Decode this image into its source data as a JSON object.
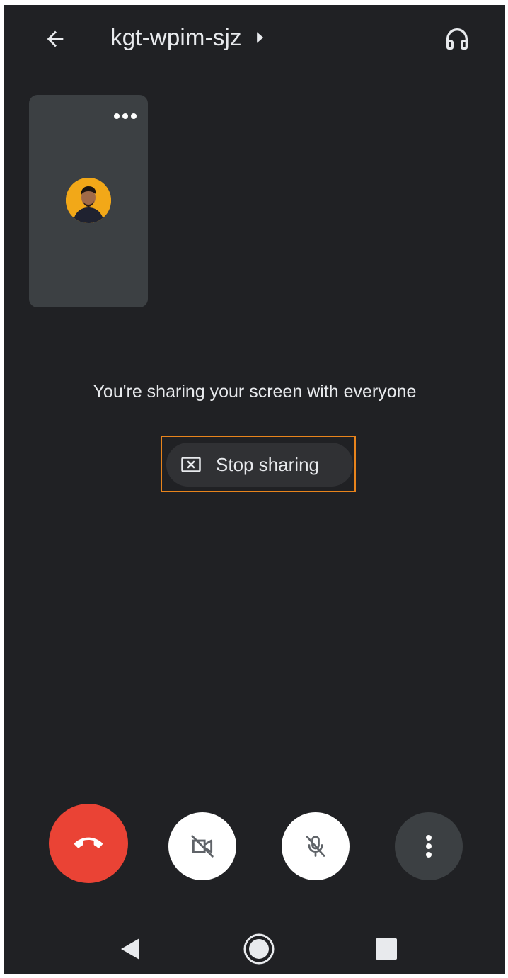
{
  "header": {
    "meeting_code": "kgt-wpim-sjz",
    "back_icon": "arrow-left-icon",
    "caret_icon": "caret-right-icon",
    "audio_icon": "headphones-icon"
  },
  "self_tile": {
    "more_icon": "more-horizontal-icon",
    "avatar_color": "#f2a818"
  },
  "sharing": {
    "message": "You're sharing your screen with everyone",
    "stop_label": "Stop sharing",
    "stop_icon": "stop-share-icon",
    "highlight_color": "#e8841c"
  },
  "controls": {
    "hangup_icon": "phone-hangup-icon",
    "camera_icon": "camera-off-icon",
    "mic_icon": "mic-off-icon",
    "more_icon": "more-vertical-icon",
    "hangup_color": "#ea4335"
  },
  "system_nav": {
    "back_icon": "nav-back-triangle-icon",
    "home_icon": "nav-home-circle-icon",
    "recents_icon": "nav-recents-square-icon"
  }
}
